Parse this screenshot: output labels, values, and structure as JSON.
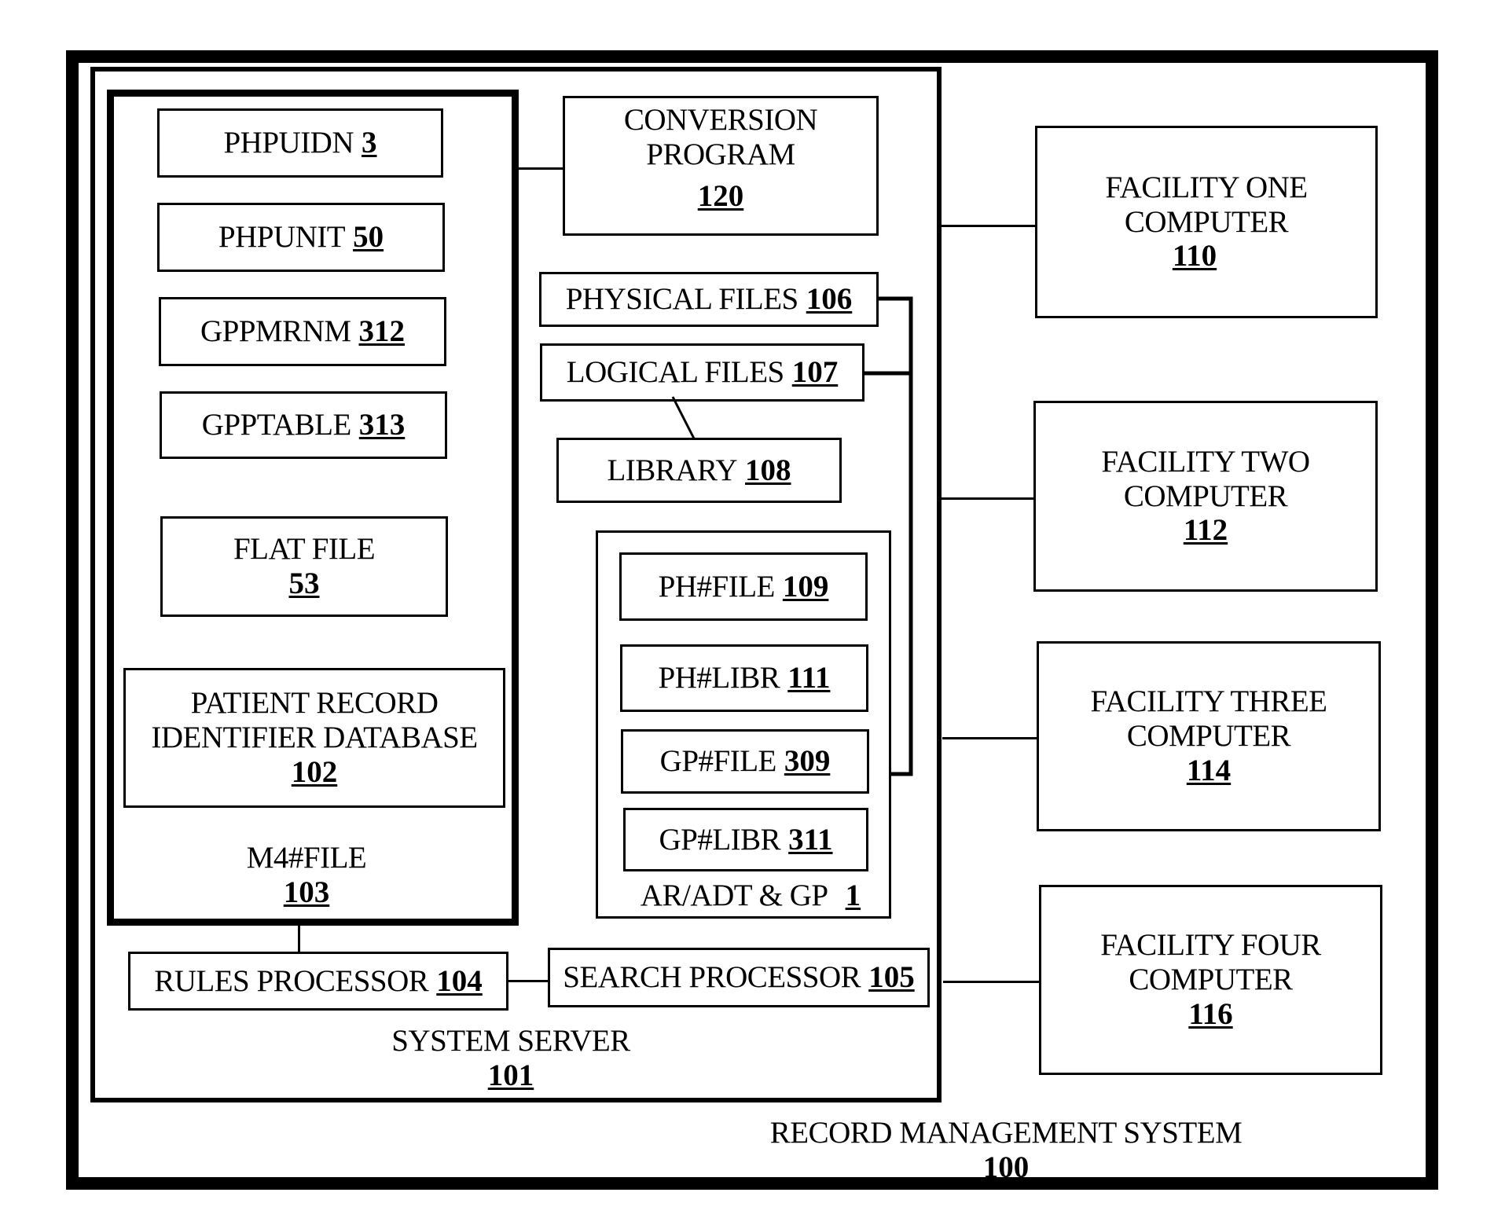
{
  "diagram": {
    "title": "RECORD MANAGEMENT SYSTEM",
    "title_ref": "100",
    "system_server": {
      "label": "SYSTEM SERVER",
      "ref": "101",
      "m4_file": {
        "label": "M4#FILE",
        "ref": "103",
        "items": [
          {
            "label": "PHPUIDN",
            "ref": "3"
          },
          {
            "label": "PHPUNIT",
            "ref": "50"
          },
          {
            "label": "GPPMRNM",
            "ref": "312"
          },
          {
            "label": "GPPTABLE",
            "ref": "313"
          },
          {
            "label": "FLAT FILE",
            "ref": "53"
          },
          {
            "label_line1": "PATIENT RECORD",
            "label_line2": "IDENTIFIER DATABASE",
            "ref": "102"
          }
        ]
      },
      "conversion_program": {
        "label_line1": "CONVERSION",
        "label_line2": "PROGRAM",
        "ref": "120"
      },
      "physical_files": {
        "label": "PHYSICAL FILES",
        "ref": "106"
      },
      "logical_files": {
        "label": "LOGICAL FILES",
        "ref": "107"
      },
      "library": {
        "label": "LIBRARY",
        "ref": "108"
      },
      "ar_adt_gp": {
        "label": "AR/ADT & GP",
        "ref": "1",
        "items": [
          {
            "label": "PH#FILE",
            "ref": "109"
          },
          {
            "label": "PH#LIBR",
            "ref": "111"
          },
          {
            "label": "GP#FILE",
            "ref": "309"
          },
          {
            "label": "GP#LIBR",
            "ref": "311"
          }
        ]
      },
      "rules_processor": {
        "label": "RULES PROCESSOR",
        "ref": "104"
      },
      "search_processor": {
        "label": "SEARCH PROCESSOR",
        "ref": "105"
      }
    },
    "facilities": [
      {
        "label_line1": "FACILITY ONE",
        "label_line2": "COMPUTER",
        "ref": "110"
      },
      {
        "label_line1": "FACILITY TWO",
        "label_line2": "COMPUTER",
        "ref": "112"
      },
      {
        "label_line1": "FACILITY THREE",
        "label_line2": "COMPUTER",
        "ref": "114"
      },
      {
        "label_line1": "FACILITY FOUR",
        "label_line2": "COMPUTER",
        "ref": "116"
      }
    ]
  }
}
